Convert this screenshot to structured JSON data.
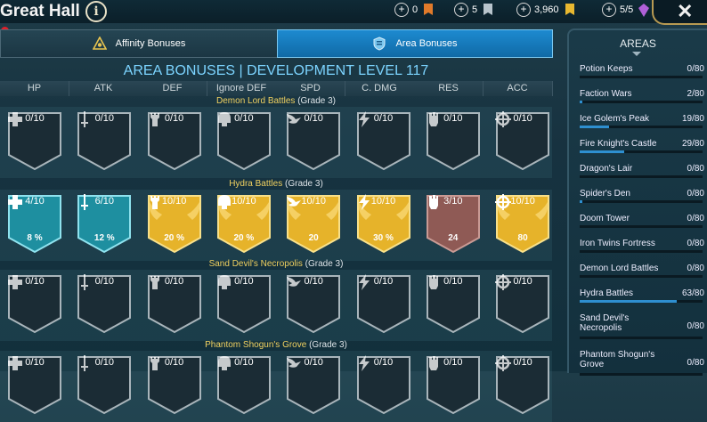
{
  "header": {
    "title": "Great Hall",
    "info_icon": "i",
    "resources": [
      {
        "value": "0",
        "icon": "orange-banner-icon",
        "color": "#e07a2a"
      },
      {
        "value": "5",
        "icon": "silver-banner-icon",
        "color": "#b8c4cc"
      },
      {
        "value": "3,960",
        "icon": "gold-banner-icon",
        "color": "#e8b830"
      },
      {
        "value": "5/5",
        "icon": "gem-icon",
        "color": "#b060d8"
      }
    ],
    "close": "✕"
  },
  "tabs": [
    {
      "label": "Affinity Bonuses",
      "active": false
    },
    {
      "label": "Area Bonuses",
      "active": true
    }
  ],
  "main": {
    "heading": "AREA BONUSES | DEVELOPMENT LEVEL 117",
    "columns": [
      "HP",
      "ATK",
      "DEF",
      "Ignore DEF",
      "SPD",
      "C. DMG",
      "RES",
      "ACC"
    ],
    "sections": [
      {
        "name": "Demon Lord Battles",
        "grade": "(Grade 3)",
        "cards": [
          {
            "count": "0/10",
            "value": "",
            "style": "empty",
            "icon": "hp-cross-icon"
          },
          {
            "count": "0/10",
            "value": "",
            "style": "empty",
            "icon": "sword-icon"
          },
          {
            "count": "0/10",
            "value": "",
            "style": "empty",
            "icon": "tower-icon"
          },
          {
            "count": "0/10",
            "value": "",
            "style": "empty",
            "icon": "helmet-icon"
          },
          {
            "count": "0/10",
            "value": "",
            "style": "empty",
            "icon": "wing-icon"
          },
          {
            "count": "0/10",
            "value": "",
            "style": "empty",
            "icon": "lightning-icon"
          },
          {
            "count": "0/10",
            "value": "",
            "style": "empty",
            "icon": "fist-icon"
          },
          {
            "count": "0/10",
            "value": "",
            "style": "empty",
            "icon": "crosshair-icon"
          }
        ]
      },
      {
        "name": "Hydra Battles",
        "grade": "(Grade 3)",
        "cards": [
          {
            "count": "4/10",
            "value": "8 %",
            "style": "teal",
            "icon": "hp-cross-icon"
          },
          {
            "count": "6/10",
            "value": "12 %",
            "style": "teal",
            "icon": "sword-icon"
          },
          {
            "count": "10/10",
            "value": "20 %",
            "style": "gold",
            "icon": "tower-icon"
          },
          {
            "count": "10/10",
            "value": "20 %",
            "style": "gold",
            "icon": "helmet-icon"
          },
          {
            "count": "10/10",
            "value": "20",
            "style": "gold",
            "icon": "wing-icon"
          },
          {
            "count": "10/10",
            "value": "30 %",
            "style": "gold",
            "icon": "lightning-icon"
          },
          {
            "count": "3/10",
            "value": "24",
            "style": "rose",
            "icon": "fist-icon"
          },
          {
            "count": "10/10",
            "value": "80",
            "style": "gold",
            "icon": "crosshair-icon"
          }
        ]
      },
      {
        "name": "Sand Devil's Necropolis",
        "grade": "(Grade 3)",
        "cards": [
          {
            "count": "0/10",
            "value": "",
            "style": "empty",
            "icon": "hp-cross-icon"
          },
          {
            "count": "0/10",
            "value": "",
            "style": "empty",
            "icon": "sword-icon"
          },
          {
            "count": "0/10",
            "value": "",
            "style": "empty",
            "icon": "tower-icon"
          },
          {
            "count": "0/10",
            "value": "",
            "style": "empty",
            "icon": "helmet-icon"
          },
          {
            "count": "0/10",
            "value": "",
            "style": "empty",
            "icon": "wing-icon"
          },
          {
            "count": "0/10",
            "value": "",
            "style": "empty",
            "icon": "lightning-icon"
          },
          {
            "count": "0/10",
            "value": "",
            "style": "empty",
            "icon": "fist-icon"
          },
          {
            "count": "0/10",
            "value": "",
            "style": "empty",
            "icon": "crosshair-icon"
          }
        ]
      },
      {
        "name": "Phantom Shogun's Grove",
        "grade": "(Grade 3)",
        "cards": [
          {
            "count": "0/10",
            "value": "",
            "style": "empty",
            "icon": "hp-cross-icon"
          },
          {
            "count": "0/10",
            "value": "",
            "style": "empty",
            "icon": "sword-icon"
          },
          {
            "count": "0/10",
            "value": "",
            "style": "empty",
            "icon": "tower-icon"
          },
          {
            "count": "0/10",
            "value": "",
            "style": "empty",
            "icon": "helmet-icon"
          },
          {
            "count": "0/10",
            "value": "",
            "style": "empty",
            "icon": "wing-icon"
          },
          {
            "count": "0/10",
            "value": "",
            "style": "empty",
            "icon": "lightning-icon"
          },
          {
            "count": "0/10",
            "value": "",
            "style": "empty",
            "icon": "fist-icon"
          },
          {
            "count": "0/10",
            "value": "",
            "style": "empty",
            "icon": "crosshair-icon"
          }
        ]
      }
    ]
  },
  "areas": {
    "title": "AREAS",
    "items": [
      {
        "name": "Potion Keeps",
        "value": "0/80",
        "progress": 0
      },
      {
        "name": "Faction Wars",
        "value": "2/80",
        "progress": 0.025
      },
      {
        "name": "Ice Golem's Peak",
        "value": "19/80",
        "progress": 0.2375
      },
      {
        "name": "Fire Knight's Castle",
        "value": "29/80",
        "progress": 0.3625
      },
      {
        "name": "Dragon's Lair",
        "value": "0/80",
        "progress": 0
      },
      {
        "name": "Spider's Den",
        "value": "0/80",
        "progress": 0.02
      },
      {
        "name": "Doom Tower",
        "value": "0/80",
        "progress": 0
      },
      {
        "name": "Iron Twins Fortress",
        "value": "0/80",
        "progress": 0
      },
      {
        "name": "Demon Lord Battles",
        "value": "0/80",
        "progress": 0
      },
      {
        "name": "Hydra Battles",
        "value": "63/80",
        "progress": 0.7875
      },
      {
        "name": "Sand Devil's Necropolis",
        "value": "0/80",
        "progress": 0
      },
      {
        "name": "Phantom Shogun's Grove",
        "value": "0/80",
        "progress": 0
      }
    ]
  }
}
